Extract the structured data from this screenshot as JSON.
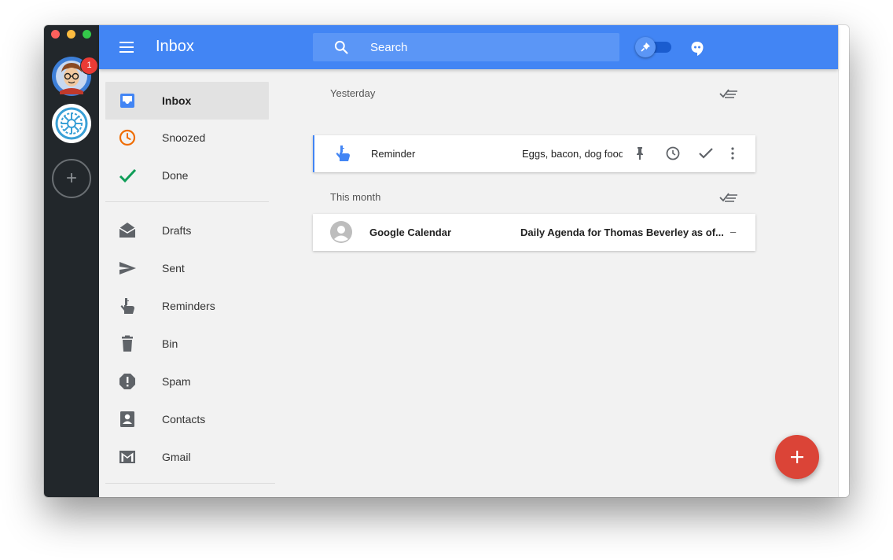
{
  "accounts": {
    "badge_count": "1",
    "add_symbol": "+"
  },
  "topbar": {
    "title": "Inbox",
    "search_placeholder": "Search"
  },
  "sidebar": {
    "items": [
      {
        "label": "Inbox",
        "icon": "inbox-icon",
        "active": true
      },
      {
        "label": "Snoozed",
        "icon": "clock-icon"
      },
      {
        "label": "Done",
        "icon": "check-icon"
      },
      {
        "label": "Drafts",
        "icon": "drafts-icon"
      },
      {
        "label": "Sent",
        "icon": "send-icon"
      },
      {
        "label": "Reminders",
        "icon": "reminder-hand-icon"
      },
      {
        "label": "Bin",
        "icon": "trash-icon"
      },
      {
        "label": "Spam",
        "icon": "spam-icon"
      },
      {
        "label": "Contacts",
        "icon": "contacts-icon"
      },
      {
        "label": "Gmail",
        "icon": "gmail-icon"
      }
    ]
  },
  "sections": [
    {
      "label": "Yesterday",
      "items": [
        {
          "sender": "Reminder",
          "snippet": "Eggs, bacon, dog food",
          "type": "reminder"
        }
      ]
    },
    {
      "label": "This month",
      "items": [
        {
          "sender": "Google Calendar",
          "snippet": "Daily Agenda for Thomas Beverley as of...",
          "trailing": "–",
          "type": "email"
        }
      ]
    }
  ],
  "fab": {
    "symbol": "+"
  },
  "colors": {
    "brand": "#4285f4",
    "account_rail": "#22272b",
    "fab": "#db4437",
    "done": "#0f9d58",
    "snoozed": "#ef6c00"
  }
}
